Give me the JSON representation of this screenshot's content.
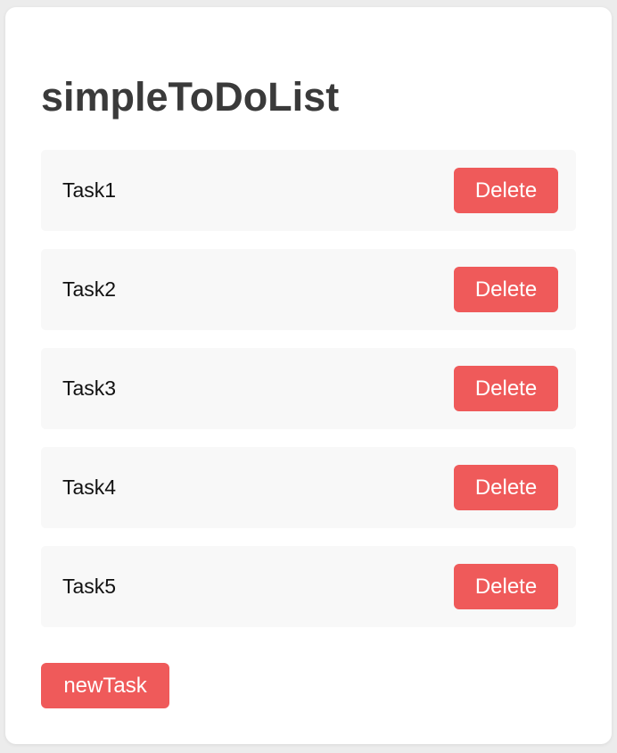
{
  "app": {
    "title": "simpleToDoList"
  },
  "tasks": [
    {
      "label": "Task1",
      "delete_label": "Delete"
    },
    {
      "label": "Task2",
      "delete_label": "Delete"
    },
    {
      "label": "Task3",
      "delete_label": "Delete"
    },
    {
      "label": "Task4",
      "delete_label": "Delete"
    },
    {
      "label": "Task5",
      "delete_label": "Delete"
    }
  ],
  "actions": {
    "new_task_label": "newTask"
  },
  "colors": {
    "accent": "#ef5a5a",
    "item_background": "#f8f8f8",
    "title_text": "#3a3a3a"
  }
}
